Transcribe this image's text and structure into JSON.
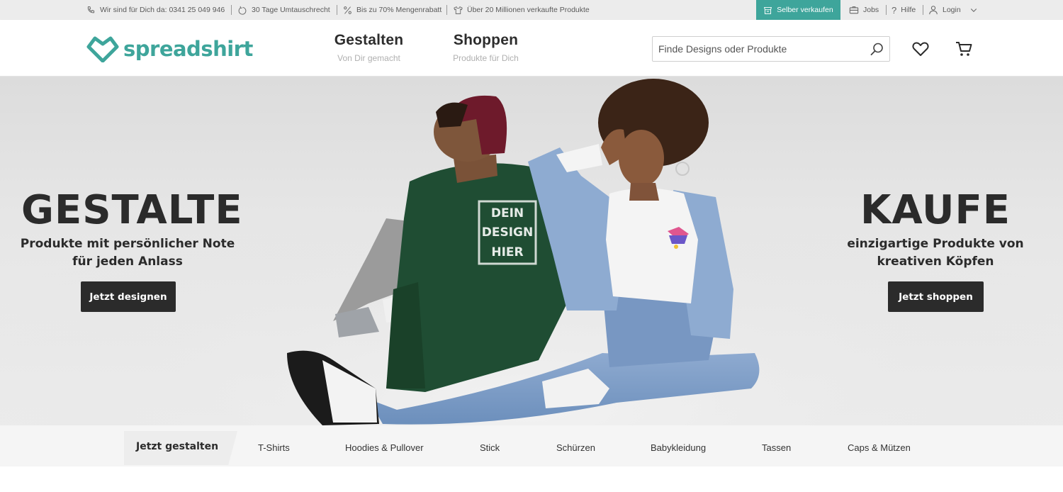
{
  "topbar": {
    "usps": [
      {
        "icon": "phone-icon",
        "text": "Wir sind für Dich da: 0341 25 049 946"
      },
      {
        "icon": "return-icon",
        "text": "30 Tage Umtauschrecht"
      },
      {
        "icon": "percent-icon",
        "text": "Bis zu 70% Mengenrabatt"
      },
      {
        "icon": "shirt-icon",
        "text": "Über 20 Millionen verkaufte Produkte"
      }
    ],
    "sell_label": "Selber verkaufen",
    "jobs_label": "Jobs",
    "help_label": "Hilfe",
    "login_label": "Login"
  },
  "header": {
    "logo_text": "spreadshirt",
    "nav": [
      {
        "title": "Gestalten",
        "subtitle": "Von Dir gemacht"
      },
      {
        "title": "Shoppen",
        "subtitle": "Produkte für Dich"
      }
    ],
    "search_placeholder": "Finde Designs oder Produkte"
  },
  "hero": {
    "left": {
      "heading": "GESTALTE",
      "line1": "Produkte mit persönlicher Note",
      "line2": "für jeden Anlass",
      "button": "Jetzt designen"
    },
    "right": {
      "heading": "KAUFE",
      "line1": "einzigartige Produkte von",
      "line2": "kreativen Köpfen",
      "button": "Jetzt shoppen"
    },
    "sweatshirt_print": [
      "DEIN",
      "DESIGN",
      "HIER"
    ]
  },
  "categories": {
    "lead": "Jetzt gestalten",
    "items": [
      "T-Shirts",
      "Hoodies & Pullover",
      "Stick",
      "Schürzen",
      "Babykleidung",
      "Tassen",
      "Caps & Mützen"
    ]
  },
  "colors": {
    "brand": "#3ea59b",
    "dark_button": "#2b2b2b",
    "sweatshirt": "#1f4d33",
    "beanie": "#6e1a2b",
    "denim": "#7f9ec4"
  }
}
